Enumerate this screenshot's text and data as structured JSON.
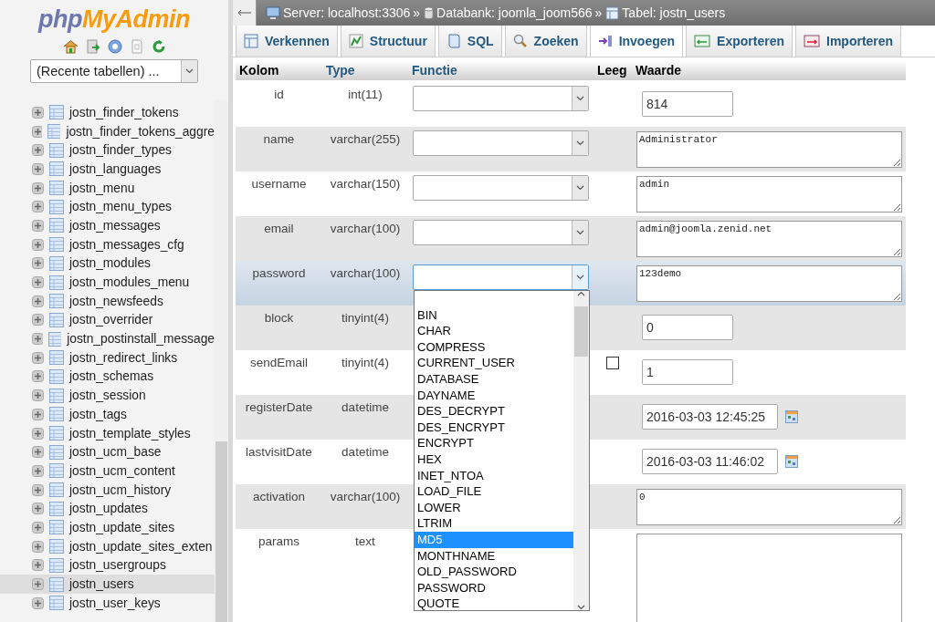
{
  "logo": {
    "prefix": "php",
    "name": "MyAdmin"
  },
  "recent_tables": {
    "value": "(Recente tabellen) ..."
  },
  "tables": [
    {
      "name": "jostn_finder_tokens",
      "selected": false
    },
    {
      "name": "jostn_finder_tokens_aggre",
      "selected": false
    },
    {
      "name": "jostn_finder_types",
      "selected": false
    },
    {
      "name": "jostn_languages",
      "selected": false
    },
    {
      "name": "jostn_menu",
      "selected": false
    },
    {
      "name": "jostn_menu_types",
      "selected": false
    },
    {
      "name": "jostn_messages",
      "selected": false
    },
    {
      "name": "jostn_messages_cfg",
      "selected": false
    },
    {
      "name": "jostn_modules",
      "selected": false
    },
    {
      "name": "jostn_modules_menu",
      "selected": false
    },
    {
      "name": "jostn_newsfeeds",
      "selected": false
    },
    {
      "name": "jostn_overrider",
      "selected": false
    },
    {
      "name": "jostn_postinstall_message",
      "selected": false
    },
    {
      "name": "jostn_redirect_links",
      "selected": false
    },
    {
      "name": "jostn_schemas",
      "selected": false
    },
    {
      "name": "jostn_session",
      "selected": false
    },
    {
      "name": "jostn_tags",
      "selected": false
    },
    {
      "name": "jostn_template_styles",
      "selected": false
    },
    {
      "name": "jostn_ucm_base",
      "selected": false
    },
    {
      "name": "jostn_ucm_content",
      "selected": false
    },
    {
      "name": "jostn_ucm_history",
      "selected": false
    },
    {
      "name": "jostn_updates",
      "selected": false
    },
    {
      "name": "jostn_update_sites",
      "selected": false
    },
    {
      "name": "jostn_update_sites_exten",
      "selected": false
    },
    {
      "name": "jostn_usergroups",
      "selected": false
    },
    {
      "name": "jostn_users",
      "selected": true
    },
    {
      "name": "jostn_user_keys",
      "selected": false
    }
  ],
  "breadcrumb": [
    {
      "kind": "server",
      "label": "Server: localhost:3306",
      "separator": "»"
    },
    {
      "kind": "database",
      "label": "Databank: joomla_joom566",
      "separator": "»"
    },
    {
      "kind": "table",
      "label": "Tabel: jostn_users"
    }
  ],
  "tabs": [
    {
      "kind": "browse",
      "label": "Verkennen",
      "selected": false
    },
    {
      "kind": "structure",
      "label": "Structuur",
      "selected": false
    },
    {
      "kind": "sql",
      "label": "SQL",
      "selected": false
    },
    {
      "kind": "search",
      "label": "Zoeken",
      "selected": false
    },
    {
      "kind": "insert",
      "label": "Invoegen",
      "selected": true
    },
    {
      "kind": "export",
      "label": "Exporteren",
      "selected": false
    },
    {
      "kind": "import",
      "label": "Importeren",
      "selected": false
    }
  ],
  "columns": [
    {
      "label": "Kolom",
      "link": false
    },
    {
      "label": "Type",
      "link": true
    },
    {
      "label": "Functie",
      "link": true
    },
    {
      "label": "Leeg",
      "link": false
    },
    {
      "label": "Waarde",
      "link": false
    }
  ],
  "rows": [
    {
      "column": "id",
      "type": "int(11)",
      "function_select": true,
      "marked": false,
      "kind": "input",
      "value": "814"
    },
    {
      "column": "name",
      "type": "varchar(255)",
      "function_select": true,
      "marked": false,
      "kind": "textarea",
      "value": "Administrator"
    },
    {
      "column": "username",
      "type": "varchar(150)",
      "function_select": true,
      "marked": false,
      "kind": "textarea",
      "value": "admin"
    },
    {
      "column": "email",
      "type": "varchar(100)",
      "function_select": true,
      "marked": false,
      "kind": "textarea",
      "value": "admin@joomla.zenid.net"
    },
    {
      "column": "password",
      "type": "varchar(100)",
      "function_select": true,
      "marked": true,
      "kind": "textarea",
      "value": "123demo",
      "function_menu": {
        "options": [
          {
            "label": "BIN",
            "selected": false
          },
          {
            "label": "CHAR",
            "selected": false
          },
          {
            "label": "COMPRESS",
            "selected": false
          },
          {
            "label": "CURRENT_USER",
            "selected": false
          },
          {
            "label": "DATABASE",
            "selected": false
          },
          {
            "label": "DAYNAME",
            "selected": false
          },
          {
            "label": "DES_DECRYPT",
            "selected": false
          },
          {
            "label": "DES_ENCRYPT",
            "selected": false
          },
          {
            "label": "ENCRYPT",
            "selected": false
          },
          {
            "label": "HEX",
            "selected": false
          },
          {
            "label": "INET_NTOA",
            "selected": false
          },
          {
            "label": "LOAD_FILE",
            "selected": false
          },
          {
            "label": "LOWER",
            "selected": false
          },
          {
            "label": "LTRIM",
            "selected": false
          },
          {
            "label": "MD5",
            "selected": true
          },
          {
            "label": "MONTHNAME",
            "selected": false
          },
          {
            "label": "OLD_PASSWORD",
            "selected": false
          },
          {
            "label": "PASSWORD",
            "selected": false
          },
          {
            "label": "QUOTE",
            "selected": false
          }
        ]
      }
    },
    {
      "column": "block",
      "type": "tinyint(4)",
      "function_select": false,
      "marked": false,
      "kind": "input",
      "value": "0"
    },
    {
      "column": "sendEmail",
      "type": "tinyint(4)",
      "function_select": false,
      "marked": false,
      "null_checked": false,
      "kind": "input",
      "value": "1"
    },
    {
      "column": "registerDate",
      "type": "datetime",
      "function_select": false,
      "marked": false,
      "kind": "datetime",
      "value": "2016-03-03 12:45:25"
    },
    {
      "column": "lastvisitDate",
      "type": "datetime",
      "function_select": false,
      "marked": false,
      "kind": "datetime",
      "value": "2016-03-03 11:46:02"
    },
    {
      "column": "activation",
      "type": "varchar(100)",
      "function_select": false,
      "marked": false,
      "kind": "textarea",
      "value": "0"
    },
    {
      "column": "params",
      "type": "text",
      "function_select": false,
      "marked": false,
      "kind": "textarea"
    }
  ]
}
